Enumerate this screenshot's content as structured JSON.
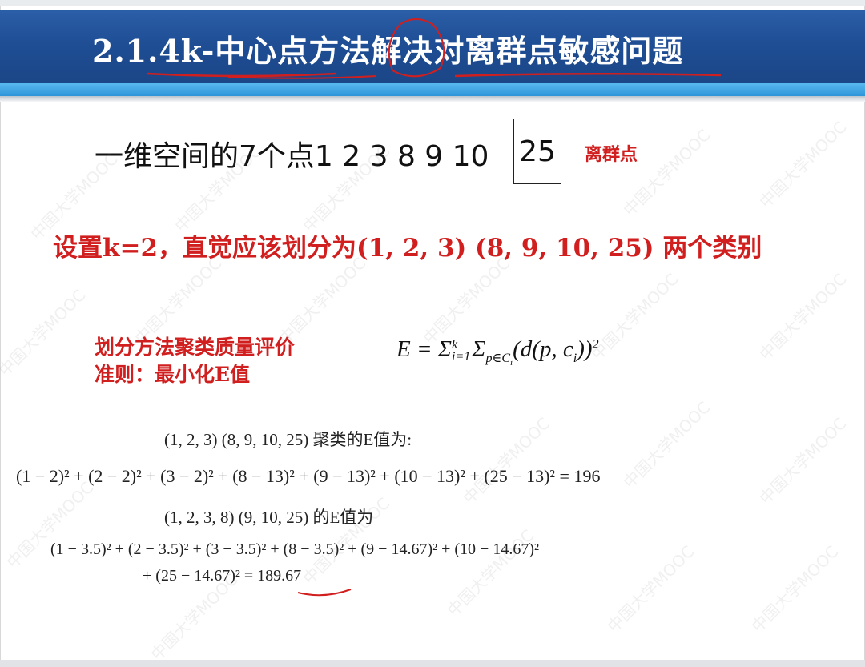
{
  "slide": {
    "title": "2.1.4k-中心点方法解决对离群点敏感问题",
    "line1_text": "一维空间的7个点1 2 3 8 9 10",
    "line1_boxed": "25",
    "outlier_label": "离群点",
    "line2": "设置k=2，直觉应该划分为(1, 2, 3) (8, 9, 10, 25) 两个类别",
    "criterion_line1": "划分方法聚类质量评价",
    "criterion_line2": "准则：最小化E值",
    "formula": {
      "lhs": "E = Σ",
      "sum1_sup": "k",
      "sum1_sub": "i=1",
      "sum2": "Σ",
      "sum2_sub": "p∈C",
      "sum2_sub_i": "i",
      "body": "(d(p, c",
      "body_sub": "i",
      "body_end": "))",
      "power": "2"
    },
    "calc1_heading": "(1, 2, 3) (8, 9, 10, 25) 聚类的E值为:",
    "calc1_line": "(1 − 2)² + (2 − 2)² + (3 − 2)² + (8 − 13)² + (9 − 13)² + (10 − 13)² + (25 − 13)² = 196",
    "calc2_heading": "(1, 2, 3, 8) (9, 10, 25) 的E值为",
    "calc2_line1": "(1 − 3.5)² + (2 − 3.5)² + (3 − 3.5)² + (8 − 3.5)² + (9 − 14.67)² + (10 − 14.67)²",
    "calc2_line2": "+ (25 − 14.67)² = 189.67",
    "watermark": "中国大学MOOC"
  },
  "colors": {
    "banner": "#1f4e95",
    "accent_stripe": "#2f95d9",
    "red_text": "#d11f1f",
    "annotation": "#d11f1f"
  }
}
